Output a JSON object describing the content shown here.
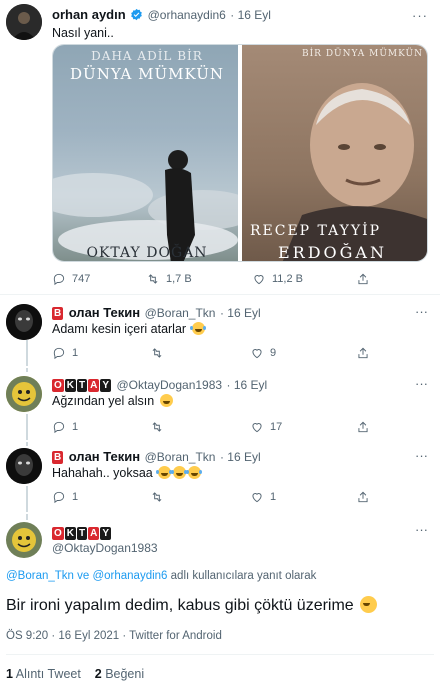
{
  "main_tweet": {
    "display_name": "orhan aydın",
    "handle": "@orhanaydin6",
    "time": "· 16 Eyl",
    "text": "Nasıl yani..",
    "image_left_caption_1": "DAHA ADİL BİR",
    "image_left_caption_2": "DÜNYA MÜMKÜN",
    "image_left_author": "OKTAY DOĞAN",
    "image_right_caption": "BİR DÜNYA MÜMKÜN",
    "image_right_author_1": "RECEP TAYYİP",
    "image_right_author_2": "ERDOĞAN",
    "replies": "747",
    "retweets": "1,7 B",
    "likes": "11,2 B"
  },
  "replies": [
    {
      "badge_letter": "B",
      "display_name": "олан Текин",
      "handle": "@Boran_Tkn",
      "time": "· 16 Eyl",
      "text": "Adamı kesin içeri atarlar",
      "reply_count": "1",
      "like_count": "9"
    },
    {
      "badge_letters": [
        "O",
        "K",
        "T",
        "A",
        "Y"
      ],
      "handle": "@OktayDogan1983",
      "time": "· 16 Eyl",
      "text": "Ağzından yel alsın",
      "reply_count": "1",
      "like_count": "17"
    },
    {
      "badge_letter": "B",
      "display_name": "олан Текин",
      "handle": "@Boran_Tkn",
      "time": "· 16 Eyl",
      "text": "Hahahah.. yoksaa",
      "reply_count": "1",
      "like_count": "1"
    }
  ],
  "focus_tweet": {
    "badge_letters": [
      "O",
      "K",
      "T",
      "A",
      "Y"
    ],
    "handle": "@OktayDogan1983",
    "replying_mentions": "@Boran_Tkn ve @orhanaydin6",
    "replying_suffix": " adlı kullanıcılara yanıt olarak",
    "text": "Bir ironi yapalım dedim, kabus gibi çöktü üzerime",
    "meta": "ÖS 9:20 · 16 Eyl 2021 · Twitter for Android",
    "quote_count": "1",
    "quote_label": "Alıntı Tweet",
    "like_count": "2",
    "like_label": "Beğeni"
  },
  "colors": {
    "accent": "#1d9bf0",
    "badge_red": "#d9282f",
    "badge_dark": "#1a1a1a",
    "muted": "#536471"
  }
}
